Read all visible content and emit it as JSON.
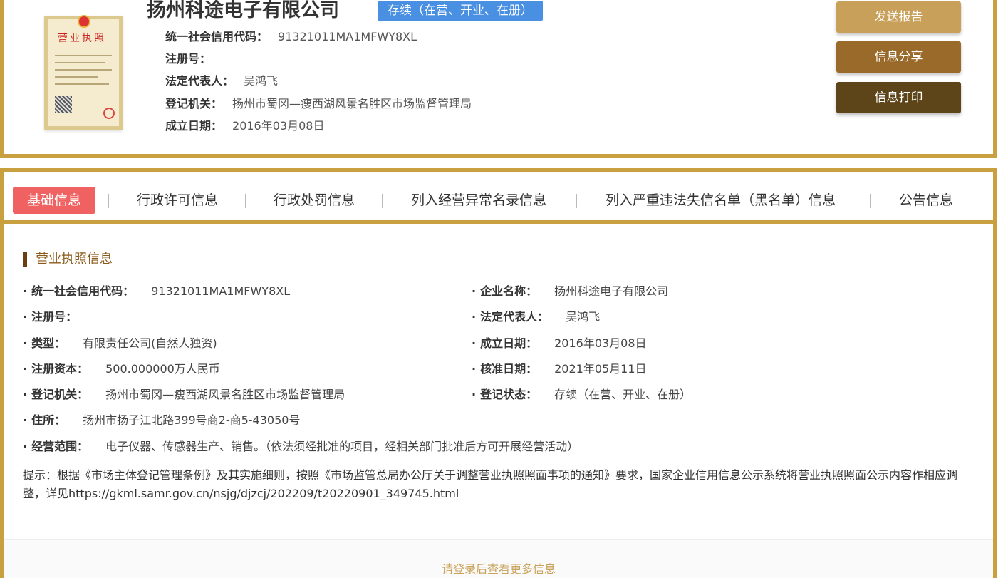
{
  "company": {
    "name": "扬州科途电子有限公司",
    "status": "存续（在营、开业、在册）",
    "rows": [
      {
        "label": "统一社会信用代码：",
        "value": "91321011MA1MFWY8XL"
      },
      {
        "label": "注册号：",
        "value": ""
      },
      {
        "label": "法定代表人：",
        "value": "吴鸿飞"
      },
      {
        "label": "登记机关：",
        "value": "扬州市蜀冈—瘦西湖风景名胜区市场监督管理局"
      },
      {
        "label": "成立日期：",
        "value": "2016年03月08日"
      }
    ]
  },
  "license_image": {
    "title": "营业执照"
  },
  "actions": {
    "report": "发送报告",
    "share": "信息分享",
    "print": "信息打印"
  },
  "tabs": [
    {
      "label": "基础信息",
      "active": true
    },
    {
      "label": "行政许可信息",
      "active": false
    },
    {
      "label": "行政处罚信息",
      "active": false
    },
    {
      "label": "列入经营异常名录信息",
      "active": false
    },
    {
      "label": "列入严重违法失信名单（黑名单）信息",
      "active": false
    },
    {
      "label": "公告信息",
      "active": false
    }
  ],
  "license_section": {
    "title": "营业执照信息",
    "left": [
      {
        "label": "统一社会信用代码：",
        "value": "91321011MA1MFWY8XL"
      },
      {
        "label": "注册号：",
        "value": ""
      },
      {
        "label": "类型：",
        "value": "有限责任公司(自然人独资)"
      },
      {
        "label": "注册资本：",
        "value": "500.000000万人民币"
      },
      {
        "label": "登记机关：",
        "value": "扬州市蜀冈—瘦西湖风景名胜区市场监督管理局"
      },
      {
        "label": "住所：",
        "value": "扬州市扬子江北路399号商2-商5-43050号"
      },
      {
        "label": "经营范围：",
        "value": "电子仪器、传感器生产、销售。（依法须经批准的项目，经相关部门批准后方可开展经营活动）"
      }
    ],
    "right": [
      {
        "label": "企业名称：",
        "value": "扬州科途电子有限公司"
      },
      {
        "label": "法定代表人：",
        "value": "吴鸿飞"
      },
      {
        "label": "成立日期：",
        "value": "2016年03月08日"
      },
      {
        "label": "核准日期：",
        "value": "2021年05月11日"
      },
      {
        "label": "登记状态：",
        "value": "存续（在营、开业、在册）"
      }
    ],
    "notice": "提示：根据《市场主体登记管理条例》及其实施细则，按照《市场监管总局办公厅关于调整营业执照照面事项的通知》要求，国家企业信用信息公示系统将营业执照照面公示内容作相应调整，详见https://gkml.samr.gov.cn/nsjg/djzcj/202209/t20220901_349745.html"
  },
  "footer": {
    "login_prompt": "请登录后查看更多信息"
  }
}
